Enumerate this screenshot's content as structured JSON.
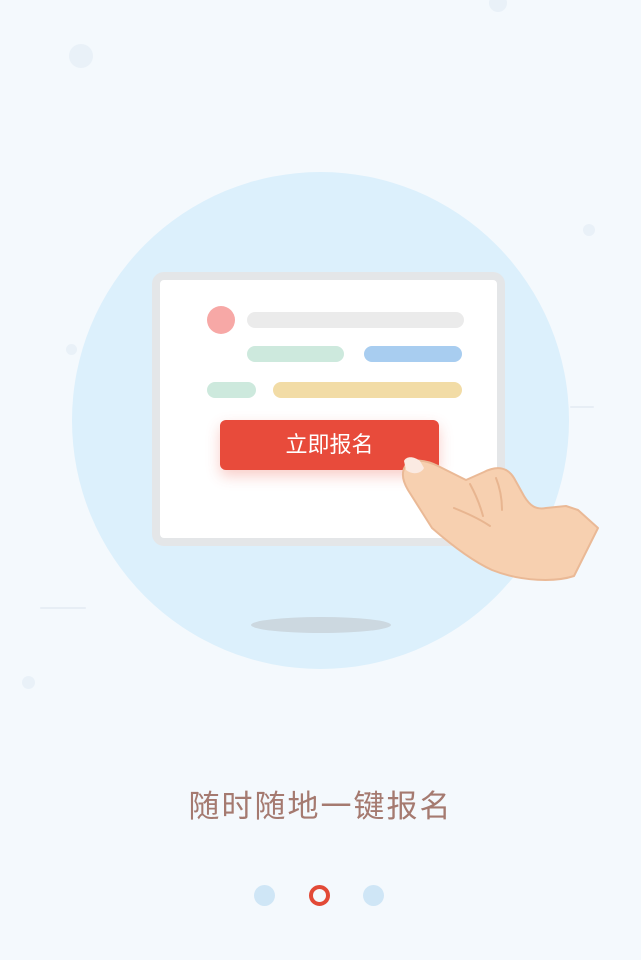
{
  "illustration": {
    "button_label": "立即报名",
    "hand_icon": "pointing-hand-icon"
  },
  "page": {
    "caption": "随时随地一键报名"
  },
  "pager": {
    "total": 3,
    "active_index": 1
  },
  "colors": {
    "background": "#f4f9fd",
    "circle": "#dcf0fc",
    "button": "#e84b3b",
    "caption": "#a57a70",
    "pager_inactive": "#cfe6f6",
    "pager_active": "#e24a37"
  }
}
